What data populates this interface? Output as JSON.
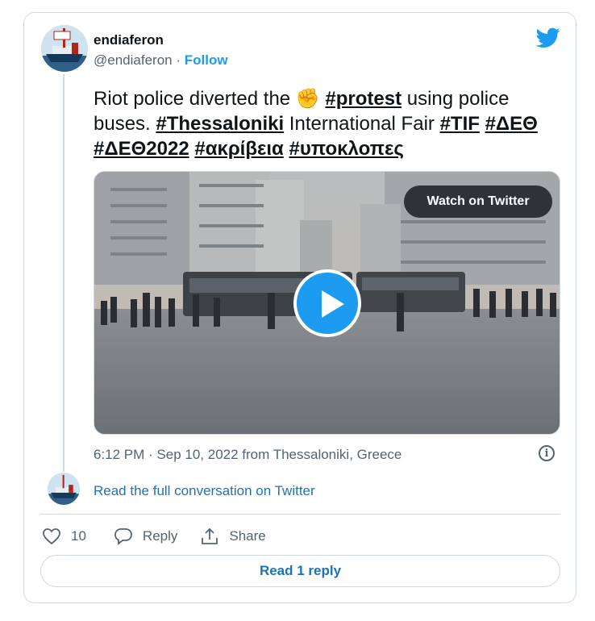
{
  "author": {
    "name": "endiaferon",
    "handle": "@endiaferon",
    "separator": "·",
    "follow_label": "Follow"
  },
  "tweet": {
    "text_intro": "Riot police diverted the",
    "emoji": "✊",
    "tag_protest": "#protest",
    "text_mid1": "using police buses.",
    "tag_thessaloniki": "#Thessaloniki",
    "text_mid2": "International Fair",
    "tag_tif": "#TIF",
    "tag_deth": "#ΔΕΘ",
    "tag_deth2022": "#ΔΕΘ2022",
    "tag_akriveia": "#ακρίβεια",
    "tag_ypoklopes": "#υποκλοπες"
  },
  "media": {
    "watch_label": "Watch on Twitter"
  },
  "meta": {
    "timestamp": "6:12 PM · Sep 10, 2022 from Thessaloniki, Greece",
    "info_glyph": "i"
  },
  "conversation_link": "Read the full conversation on Twitter",
  "actions": {
    "like_count": "10",
    "reply_label": "Reply",
    "share_label": "Share"
  },
  "read_reply_label": "Read 1 reply",
  "colors": {
    "accent": "#1d9bf0",
    "link": "#1d73b9",
    "secondary_text": "#536471",
    "border": "#cfd9de"
  },
  "icons": [
    "twitter-bird-icon",
    "play-icon",
    "info-icon",
    "heart-icon",
    "reply-bubble-icon",
    "share-icon"
  ]
}
